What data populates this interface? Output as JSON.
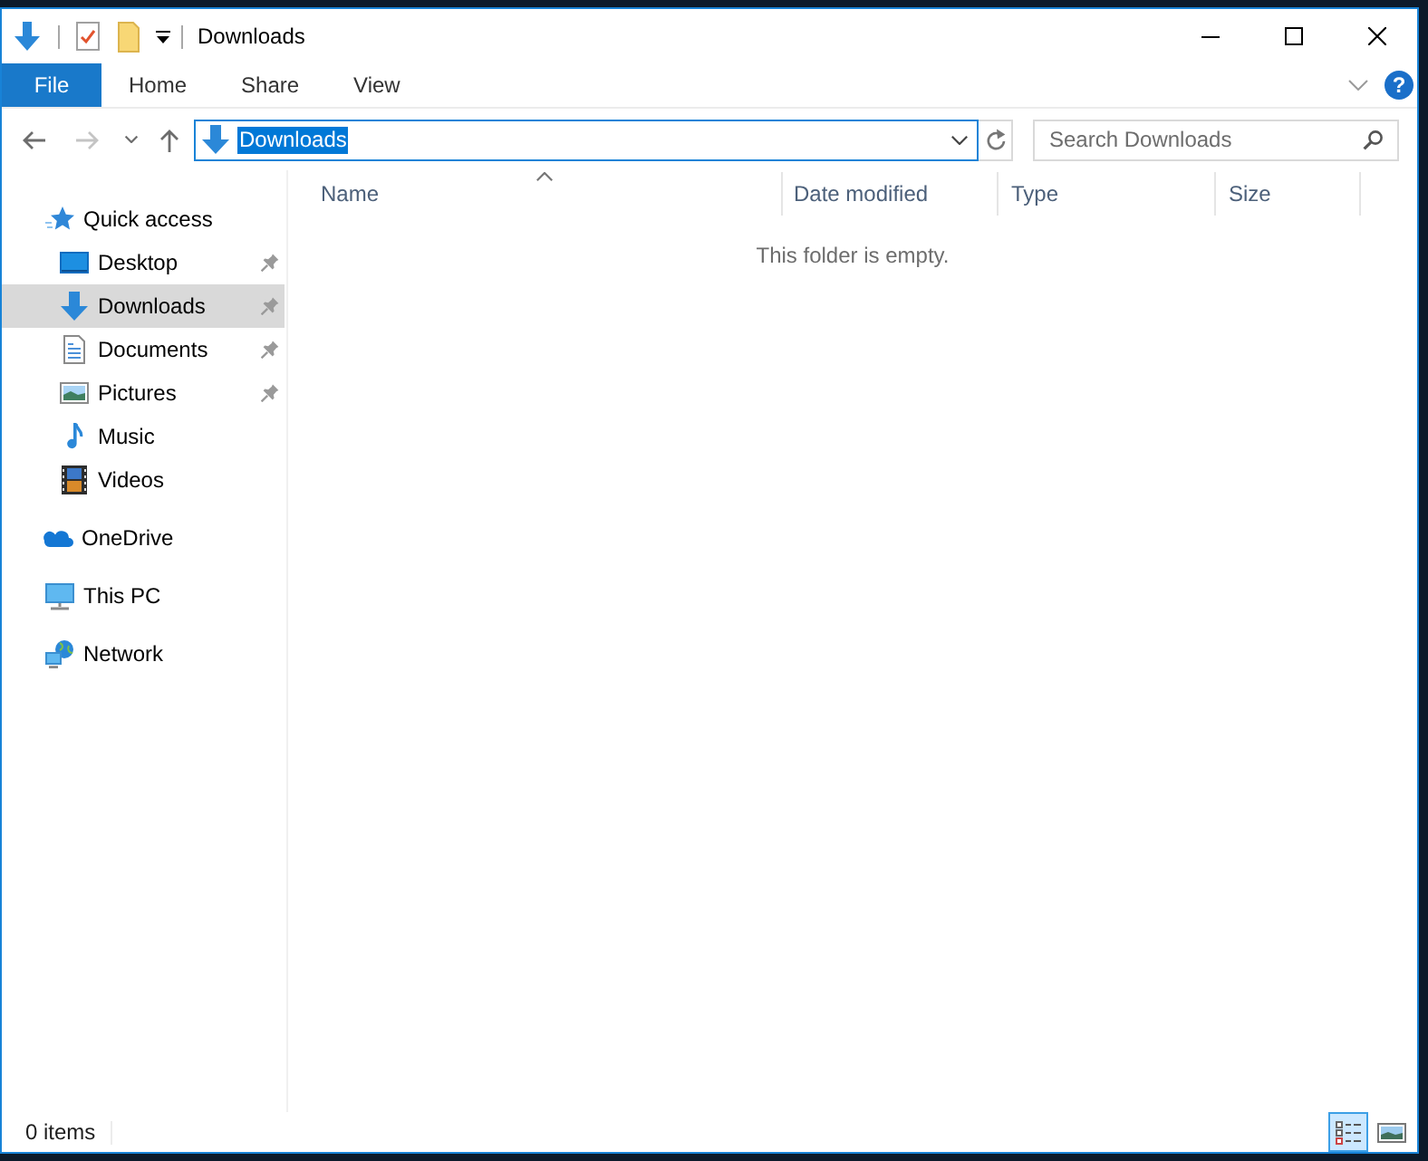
{
  "window": {
    "title": "Downloads"
  },
  "ribbon": {
    "tabs": [
      {
        "label": "File",
        "kind": "file",
        "selected": false
      },
      {
        "label": "Home",
        "kind": "tab",
        "selected": false
      },
      {
        "label": "Share",
        "kind": "tab",
        "selected": false
      },
      {
        "label": "View",
        "kind": "tab",
        "selected": false
      }
    ],
    "help": "?"
  },
  "navigation_buttons": [
    {
      "kind": "back",
      "disabled": false
    },
    {
      "kind": "forward",
      "disabled": true
    },
    {
      "kind": "recent",
      "disabled": false
    },
    {
      "kind": "up",
      "disabled": false
    }
  ],
  "address_bar": {
    "path": "Downloads",
    "text_selected": true
  },
  "search": {
    "placeholder": "Search Downloads"
  },
  "navigation_pane": {
    "items": [
      {
        "label": "Quick access",
        "kind": "quick-access",
        "selected": false,
        "children": [
          {
            "label": "Desktop",
            "kind": "desktop",
            "pinned": true,
            "selected": false
          },
          {
            "label": "Downloads",
            "kind": "downloads",
            "pinned": true,
            "selected": true
          },
          {
            "label": "Documents",
            "kind": "documents",
            "pinned": true,
            "selected": false
          },
          {
            "label": "Pictures",
            "kind": "pictures",
            "pinned": true,
            "selected": false
          },
          {
            "label": "Music",
            "kind": "music",
            "pinned": false,
            "selected": false
          },
          {
            "label": "Videos",
            "kind": "videos",
            "pinned": false,
            "selected": false
          }
        ]
      },
      {
        "label": "OneDrive",
        "kind": "onedrive",
        "selected": false
      },
      {
        "label": "This PC",
        "kind": "pc",
        "selected": false
      },
      {
        "label": "Network",
        "kind": "network",
        "selected": false
      }
    ]
  },
  "file_list": {
    "columns": [
      {
        "label": "Name",
        "sorted": true
      },
      {
        "label": "Date modified",
        "sorted": false
      },
      {
        "label": "Type",
        "sorted": false
      },
      {
        "label": "Size",
        "sorted": false
      }
    ],
    "empty_message": "This folder is empty."
  },
  "status_bar": {
    "item_count": "0 items",
    "views": [
      {
        "kind": "details",
        "selected": true
      },
      {
        "kind": "large-icons",
        "selected": false
      }
    ]
  }
}
